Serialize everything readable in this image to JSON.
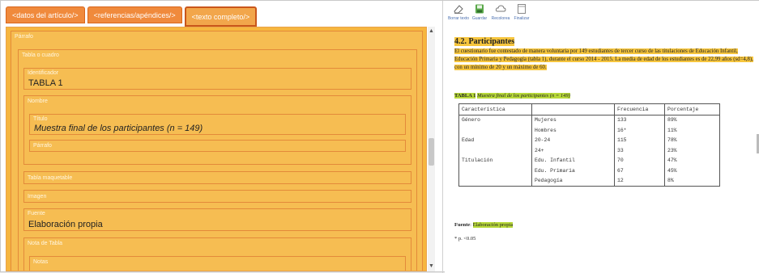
{
  "left_panel": {
    "tabs": [
      {
        "label": "<datos del artículo/>"
      },
      {
        "label": "<referencias/apéndices/>"
      },
      {
        "label": "<texto completo/>"
      }
    ],
    "fields": {
      "parrafo_top": "Párrafo",
      "tabla_o_cuadro": "Tabla o cuadro",
      "identificador_label": "Identificador",
      "identificador_value": "TABLA 1",
      "nombre_label": "Nombre",
      "titulo_label": "Título",
      "titulo_value": "Muestra final de los participantes (n = 149)",
      "parrafo_label": "Párrafo",
      "tabla_maquetable": "Tabla maquetable",
      "imagen": "Imagen",
      "fuente_label": "Fuente",
      "fuente_value": "Elaboración propia",
      "nota_tabla": "Nota de Tabla",
      "notas": "Notas"
    }
  },
  "toolbar": {
    "buttons": [
      {
        "label": "Borrar texto",
        "icon": "eraser-icon"
      },
      {
        "label": "Guardar",
        "icon": "save-icon"
      },
      {
        "label": "Recolorea",
        "icon": "cloud-icon"
      },
      {
        "label": "Finalizar",
        "icon": "document-icon"
      }
    ]
  },
  "document": {
    "heading": "4.2. Participantes",
    "paragraph": "El cuestionario fue contestado de manera voluntaria por 149 estudiantes de tercer curso de las titulaciones de Educación Infantil, Educación Primaria y Pedagogía (tabla 1), durante el curso 2014 - 2015. La media de edad de los estudiantes es de 22,99 años (sd=4,8), con un mínimo de 20 y un máximo de 60.",
    "caption_id": "TABLA 1",
    "caption_title": "Muestra final de los participantes (n = 149)",
    "table": {
      "headers": [
        "Característica",
        "",
        "Frecuencia",
        "Porcentaje"
      ],
      "rows": [
        [
          "Género",
          "Mujeres",
          "133",
          "89%"
        ],
        [
          "",
          "Hombres",
          "16*",
          "11%"
        ],
        [
          "Edad",
          "20-24",
          "115",
          "78%"
        ],
        [
          "",
          "24+",
          "33",
          "23%"
        ],
        [
          "Titulación",
          "Edu. Infantil",
          "70",
          "47%"
        ],
        [
          "",
          "Edu. Primaria",
          "67",
          "45%"
        ],
        [
          "",
          "Pedagogía",
          "12",
          "8%"
        ]
      ]
    },
    "source_label": "Fuente",
    "source_value": "Elaboración propia",
    "note": "* p. <0.05"
  },
  "colors": {
    "tab_orange": "#f08a3c",
    "panel_yellow": "#f6b63f",
    "highlight_yellow": "#f6c53d",
    "highlight_green": "#b8d93a"
  }
}
